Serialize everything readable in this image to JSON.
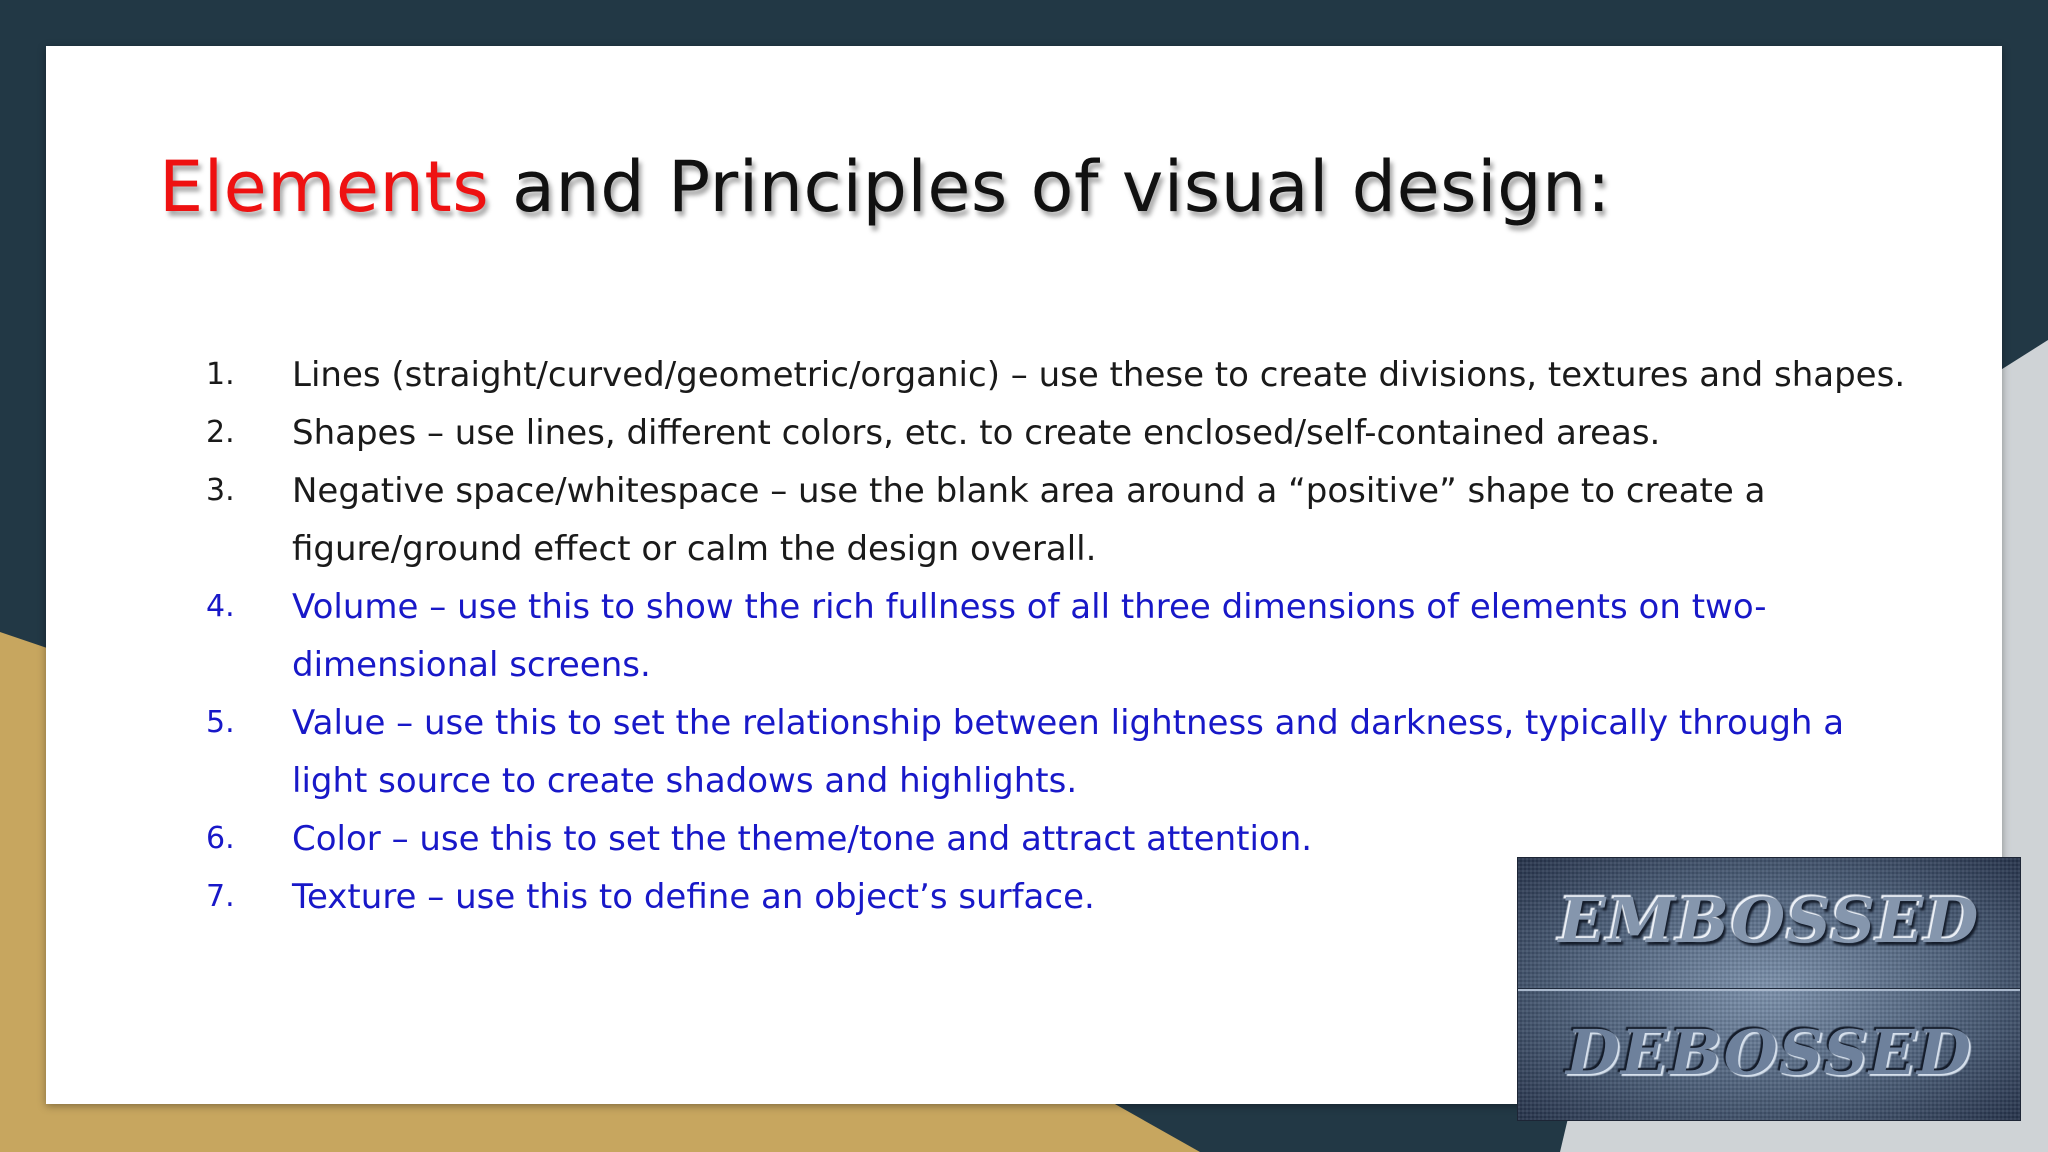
{
  "colors": {
    "background_dark": "#223845",
    "background_gold": "#c7a65f",
    "background_gray": "#cfd3d6",
    "slide": "#ffffff",
    "title_text": "#111111",
    "title_accent": "#ee1111",
    "list_black": "#1a1a1a",
    "list_blue": "#1818c8"
  },
  "slide": {
    "title": {
      "accent": "Elements",
      "rest": " and Principles of visual design:"
    },
    "items": [
      {
        "num": "1.",
        "text": "Lines (straight/curved/geometric/organic) – use these to create divisions, textures and shapes.",
        "color": "black"
      },
      {
        "num": "2.",
        "text": "Shapes – use lines, different colors, etc. to create enclosed/self-contained areas.",
        "color": "black"
      },
      {
        "num": "3.",
        "text": "Negative space/whitespace – use the blank area around a “positive” shape to create a figure/ground effect or calm the design overall.",
        "color": "black"
      },
      {
        "num": "4.",
        "text": "Volume – use this to show the rich fullness of all three dimensions of elements on two-dimensional screens.",
        "color": "blue"
      },
      {
        "num": "5.",
        "text": "Value – use this to set the relationship between lightness and darkness, typically through a light source to create shadows and highlights.",
        "color": "blue"
      },
      {
        "num": "6.",
        "text": "Color – use this to set the theme/tone and attract attention.",
        "color": "blue"
      },
      {
        "num": "7.",
        "text": "Texture – use this to define an object’s surface.",
        "color": "blue"
      }
    ],
    "image": {
      "top_word": "EMBOSSED",
      "bottom_word": "DEBOSSED"
    }
  }
}
